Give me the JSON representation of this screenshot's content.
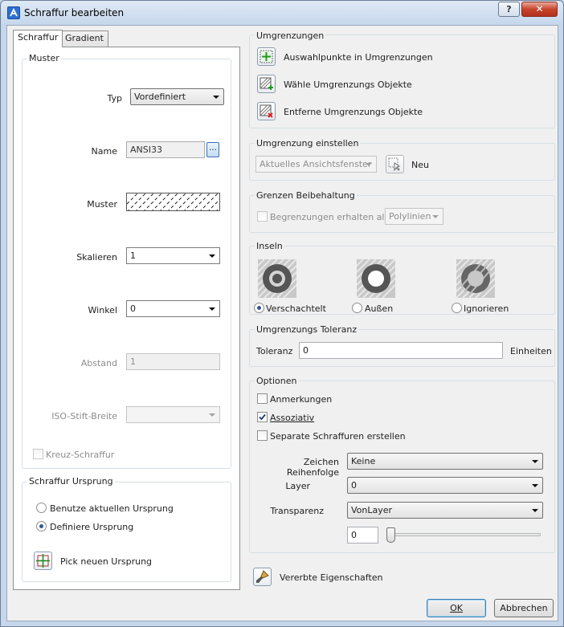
{
  "window": {
    "title": "Schraffur bearbeiten",
    "help_label": "?",
    "close_label": "✕"
  },
  "tabs": [
    {
      "label": "Schraffur"
    },
    {
      "label": "Gradient"
    }
  ],
  "muster": {
    "group_label": "Muster",
    "typ_label": "Typ",
    "typ_value": "Vordefiniert",
    "name_label": "Name",
    "name_value": "ANSI33",
    "browse_label": "...",
    "muster_label": "Muster",
    "skalieren_label": "Skalieren",
    "skalieren_value": "1",
    "winkel_label": "Winkel",
    "winkel_value": "0",
    "abstand_label": "Abstand",
    "abstand_value": "1",
    "iso_label": "ISO-Stift-Breite",
    "iso_value": "",
    "kreuz_label": "Kreuz-Schraffur"
  },
  "ursprung": {
    "group_label": "Schraffur Ursprung",
    "option1_label": "Benutze aktuellen Ursprung",
    "option2_label": "Definiere Ursprung",
    "option_selected": "Definiere Ursprung",
    "pick_label": "Pick neuen Ursprung"
  },
  "umgrenzungen": {
    "group_label": "Umgrenzungen",
    "btn1_label": "Auswahlpunkte in Umgrenzungen",
    "btn2_label": "Wähle Umgrenzungs Objekte",
    "btn3_label": "Entferne Umgrenzungs Objekte"
  },
  "umgrenzung_einstellen": {
    "group_label": "Umgrenzung einstellen",
    "combo_value": "Aktuelles Ansichtsfenster",
    "neu_label": "Neu"
  },
  "grenzen": {
    "group_label": "Grenzen Beibehaltung",
    "check_label": "Begrenzungen erhalten als",
    "combo_value": "Polylinien"
  },
  "inseln": {
    "group_label": "Inseln",
    "options": [
      {
        "label": "Verschachtelt"
      },
      {
        "label": "Außen"
      },
      {
        "label": "Ignorieren"
      }
    ],
    "selected": "Verschachtelt"
  },
  "toleranz": {
    "group_label": "Umgrenzungs Toleranz",
    "label": "Toleranz",
    "value": "0",
    "unit": "Einheiten"
  },
  "optionen": {
    "group_label": "Optionen",
    "anmerkungen_label": "Anmerkungen",
    "anmerkungen_checked": false,
    "assoziativ_label": "Assoziativ",
    "assoziativ_checked": true,
    "separate_label": "Separate Schraffuren erstellen",
    "separate_checked": false,
    "reihenfolge_label": "Zeichen Reihenfolge",
    "reihenfolge_value": "Keine",
    "layer_label": "Layer",
    "layer_value": "0",
    "transparenz_label": "Transparenz",
    "transparenz_value": "VonLayer",
    "transparenz_amount": "0"
  },
  "vererbte_label": "Vererbte Eigenschaften",
  "buttons": {
    "ok_label": "OK",
    "cancel_label": "Abbrechen"
  },
  "colors": {
    "title_bar": "#c6d7ec",
    "close_button": "#c7432c",
    "dialog_bg": "#f0f0f0"
  }
}
